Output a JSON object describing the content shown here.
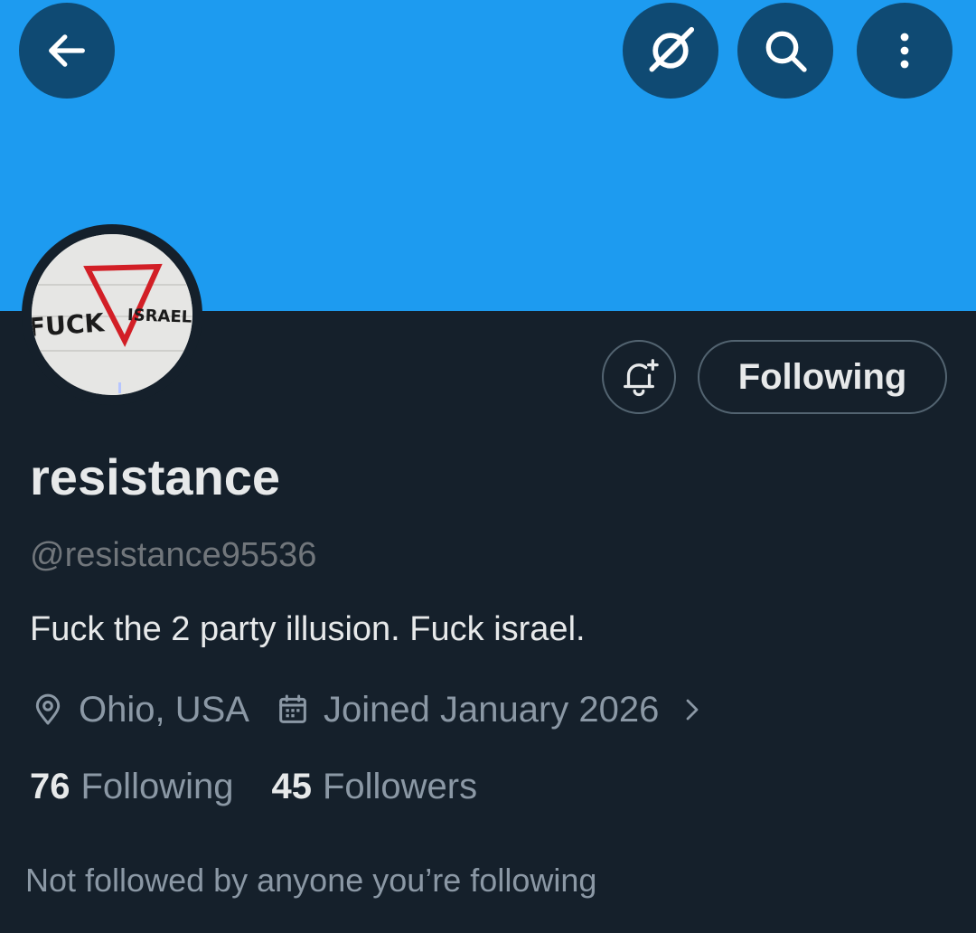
{
  "header": {
    "back_icon": "arrow-left-icon",
    "grok_icon": "grok-icon",
    "search_icon": "search-icon",
    "more_icon": "more-vertical-icon"
  },
  "banner": {
    "color": "#1d9bf0"
  },
  "avatar": {
    "image_text_left": "FUCK",
    "image_text_right": "ISRAEL"
  },
  "actions": {
    "notify_icon": "bell-plus-icon",
    "following_label": "Following"
  },
  "profile": {
    "display_name": "resistance",
    "handle": "@resistance95536",
    "bio": "Fuck the 2 party illusion. Fuck israel.",
    "location": "Ohio, USA",
    "joined": "Joined January 2026",
    "following_count": "76",
    "following_label": "Following",
    "followers_count": "45",
    "followers_label": "Followers",
    "not_followed_note": "Not followed by anyone you’re following"
  },
  "colors": {
    "background": "#15202b",
    "primary_text": "#e7e9ea",
    "secondary_text": "#8b98a5",
    "border": "#536471"
  }
}
